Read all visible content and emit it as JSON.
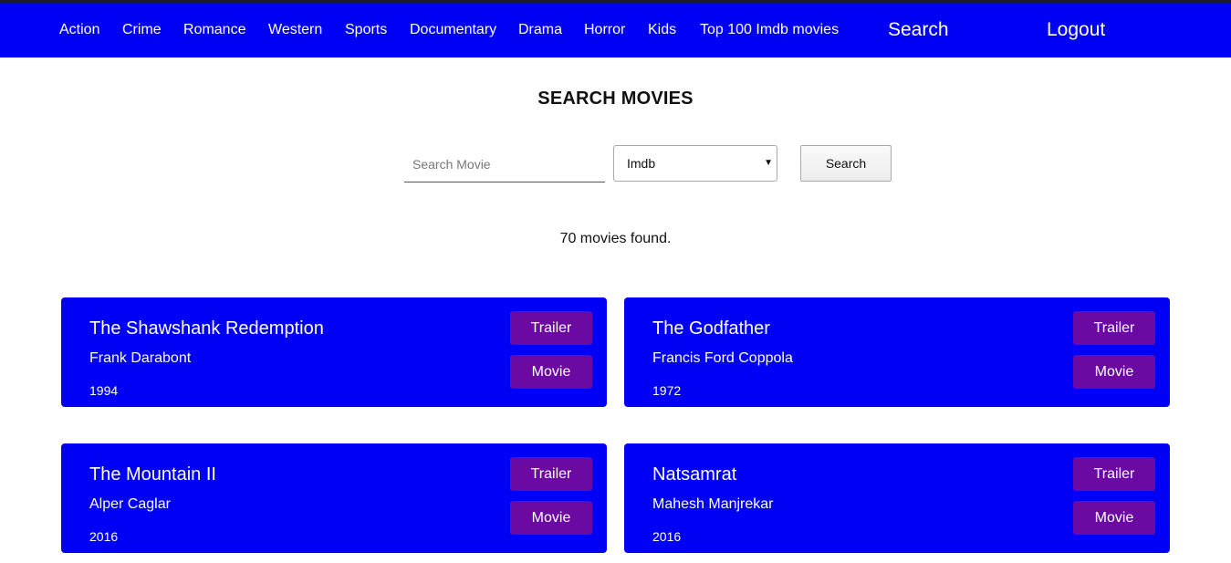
{
  "nav": {
    "items": [
      "Action",
      "Crime",
      "Romance",
      "Western",
      "Sports",
      "Documentary",
      "Drama",
      "Horror",
      "Kids",
      "Top 100 Imdb movies"
    ],
    "search": "Search",
    "logout": "Logout"
  },
  "page": {
    "title": "SEARCH MOVIES"
  },
  "search": {
    "placeholder": "Search Movie",
    "value": "",
    "source_selected": "Imdb",
    "button": "Search"
  },
  "results": {
    "count_text": "70 movies found.",
    "movies": [
      {
        "title": "The Shawshank Redemption",
        "director": "Frank Darabont",
        "year": "1994",
        "trailer": "Trailer",
        "movie": "Movie"
      },
      {
        "title": "The Godfather",
        "director": "Francis Ford Coppola",
        "year": "1972",
        "trailer": "Trailer",
        "movie": "Movie"
      },
      {
        "title": "The Mountain II",
        "director": "Alper Caglar",
        "year": "2016",
        "trailer": "Trailer",
        "movie": "Movie"
      },
      {
        "title": "Natsamrat",
        "director": "Mahesh Manjrekar",
        "year": "2016",
        "trailer": "Trailer",
        "movie": "Movie"
      }
    ]
  },
  "colors": {
    "nav_bg": "#0000f5",
    "card_bg": "#0000f5",
    "card_button": "#6a0aa2",
    "text_on_blue": "#ffffff"
  },
  "icons": {
    "select_arrow": "caret-down-icon"
  }
}
